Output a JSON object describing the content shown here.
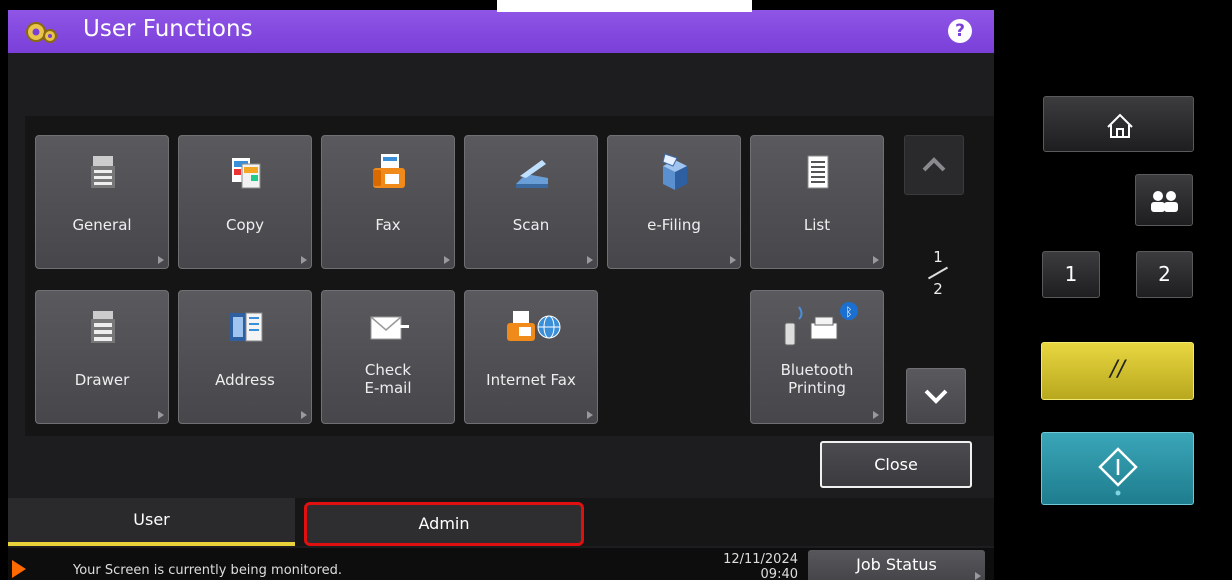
{
  "title": "User Functions",
  "help_label": "?",
  "tiles": [
    {
      "label": "General",
      "icon": "copier-icon"
    },
    {
      "label": "Copy",
      "icon": "copy-icon"
    },
    {
      "label": "Fax",
      "icon": "fax-icon"
    },
    {
      "label": "Scan",
      "icon": "scanner-icon"
    },
    {
      "label": "e-Filing",
      "icon": "efiling-box-icon"
    },
    {
      "label": "List",
      "icon": "list-icon"
    },
    {
      "label": "Drawer",
      "icon": "drawer-icon"
    },
    {
      "label": "Address",
      "icon": "address-book-icon"
    },
    {
      "label": "Check\nE-mail",
      "icon": "email-envelope-icon"
    },
    {
      "label": "Internet Fax",
      "icon": "internet-fax-icon"
    },
    {
      "label": "Bluetooth\nPrinting",
      "icon": "bluetooth-printing-icon"
    }
  ],
  "pagination": {
    "current": "1",
    "total": "2"
  },
  "close_label": "Close",
  "tabs": {
    "user": "User",
    "admin": "Admin"
  },
  "status": {
    "message": "Your Screen is currently being monitored.",
    "date": "12/11/2024",
    "time": "09:40",
    "job_status_label": "Job Status"
  },
  "hardware": {
    "one": "1",
    "two": "2",
    "reset_symbol": "//"
  },
  "colors": {
    "title_bar": "#7a3fd8",
    "user_tab_underline": "#e8d43a",
    "admin_highlight": "#e01010",
    "reset": "#e8d640",
    "start": "#2a96a8"
  }
}
